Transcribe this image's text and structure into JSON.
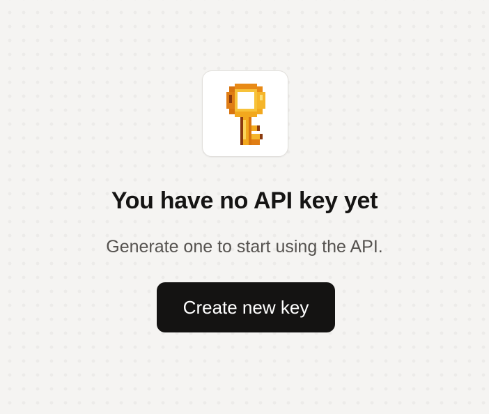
{
  "empty_state": {
    "icon": "pixel-key-icon",
    "title": "You have no API key yet",
    "subtitle": "Generate one to start using the API.",
    "button_label": "Create new key"
  },
  "colors": {
    "background": "#f5f4f2",
    "button": "#141312",
    "key_gold": "#f2a81e",
    "key_dark": "#8b3a0e"
  }
}
